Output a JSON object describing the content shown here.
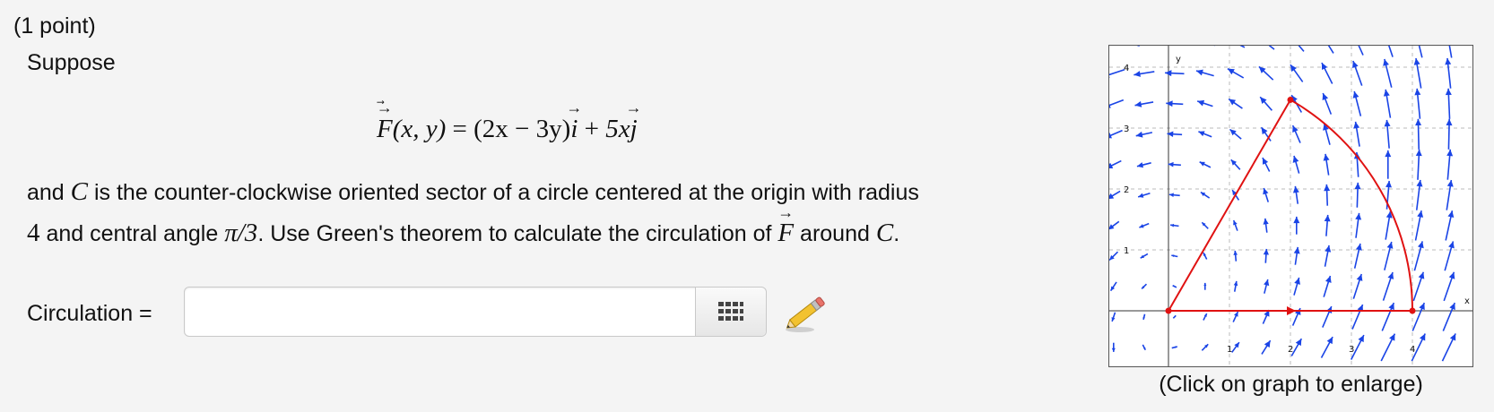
{
  "problem": {
    "points": "(1 point)",
    "intro": "Suppose",
    "equation": {
      "F": "F",
      "args": "(x, y)",
      "eq": "=",
      "coef_open": "(2x − 3y)",
      "i": "i",
      "plus": "+",
      "coef2": "5x",
      "j": "j"
    },
    "sentence1_a": "and",
    "C": "C",
    "sentence1_b": "is the counter-clockwise oriented sector of a circle centered at the origin with radius",
    "radius": "4",
    "sentence2_a": "and central angle",
    "angle": "π/3",
    "sentence2_b": ". Use Green's theorem to calculate the circulation of",
    "sentence2_c": "around",
    "period": "."
  },
  "answer": {
    "label": "Circulation =",
    "value": "",
    "placeholder": ""
  },
  "icons": {
    "keypad": "keypad-grid-icon",
    "pencil": "pencil-icon"
  },
  "graph": {
    "caption": "(Click on graph to enlarge)",
    "x_tick_labels": [
      "1",
      "2",
      "3",
      "4"
    ],
    "y_tick_labels": [
      "1",
      "2",
      "3",
      "4"
    ],
    "x_axis_label": "x",
    "y_axis_label": "y",
    "vector_color": "#1a44e6",
    "curve_color": "#e01212"
  }
}
